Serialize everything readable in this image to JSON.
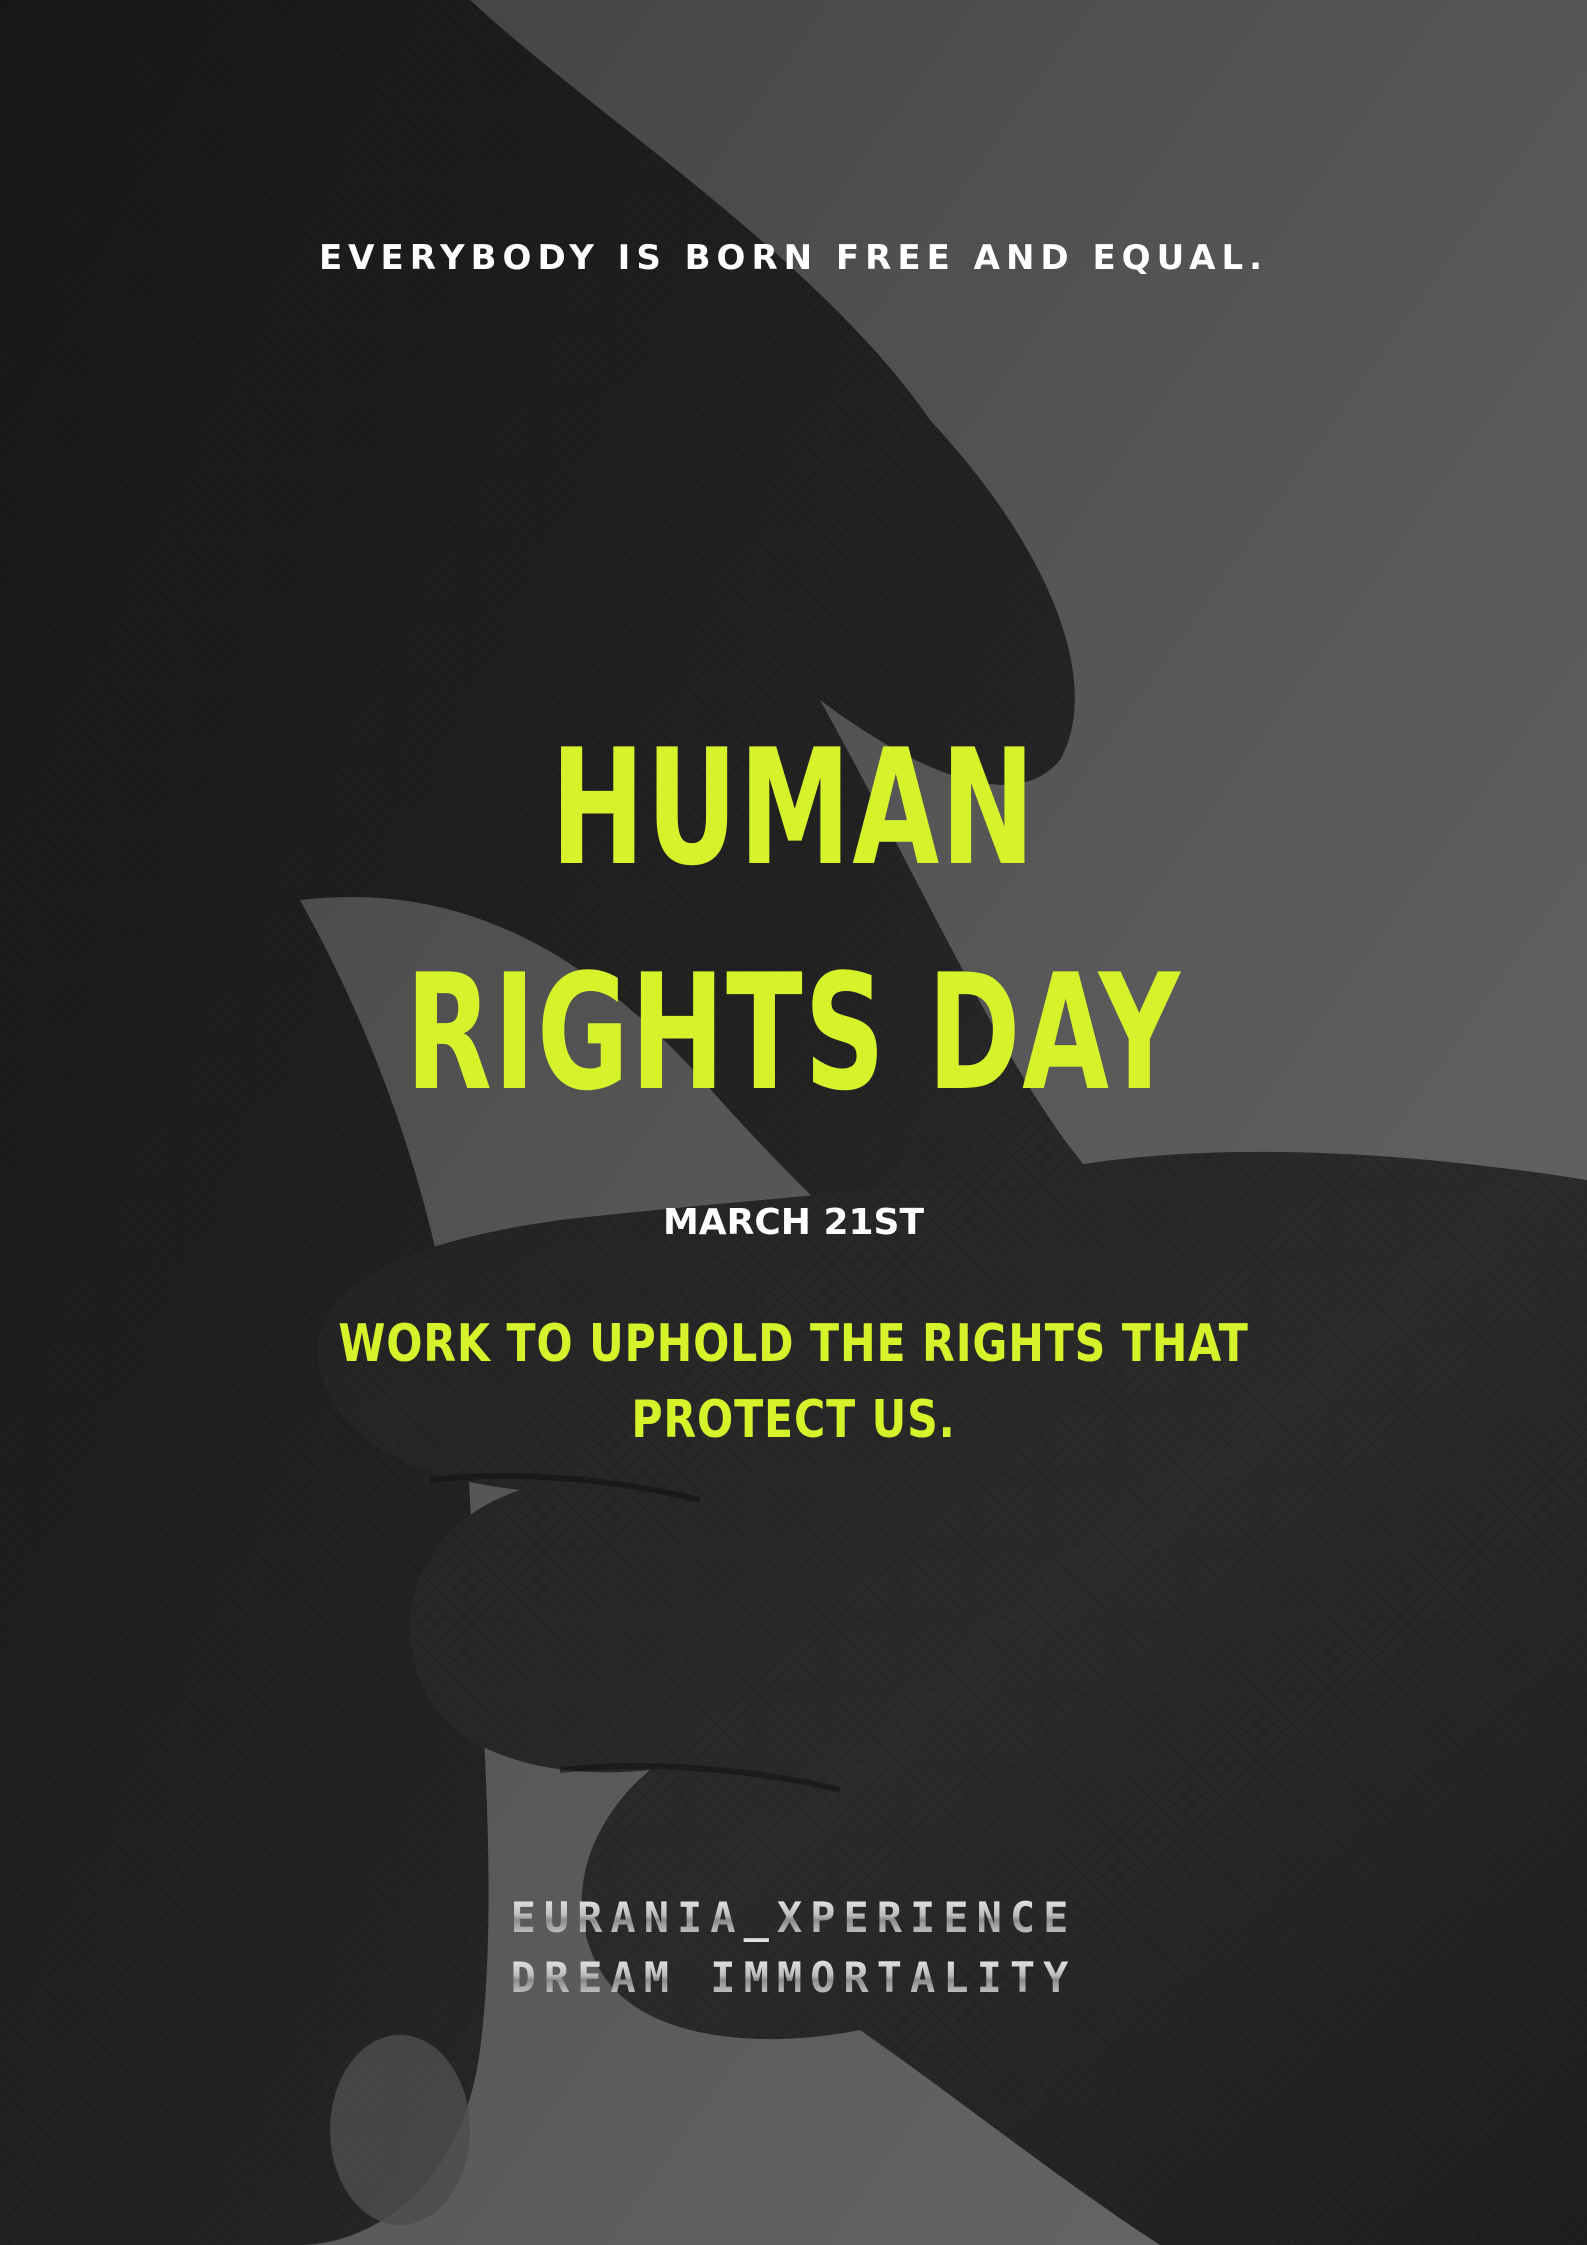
{
  "poster": {
    "tagline": "EVERYBODY IS BORN FREE AND EQUAL.",
    "title_line1": "HUMAN",
    "title_line2": "RIGHTS DAY",
    "date": "MARCH 21ST",
    "message_line1": "WORK TO UPHOLD THE RIGHTS THAT",
    "message_line2": "PROTECT US.",
    "signature_line1": "EURANIA_XPERIENCE",
    "signature_line2": "DREAM IMMORTALITY"
  },
  "colors": {
    "accent": "#d6f22a",
    "text_light": "#ffffff",
    "background": "#5a5a5a"
  },
  "image": {
    "subject": "two-hands-photo"
  }
}
